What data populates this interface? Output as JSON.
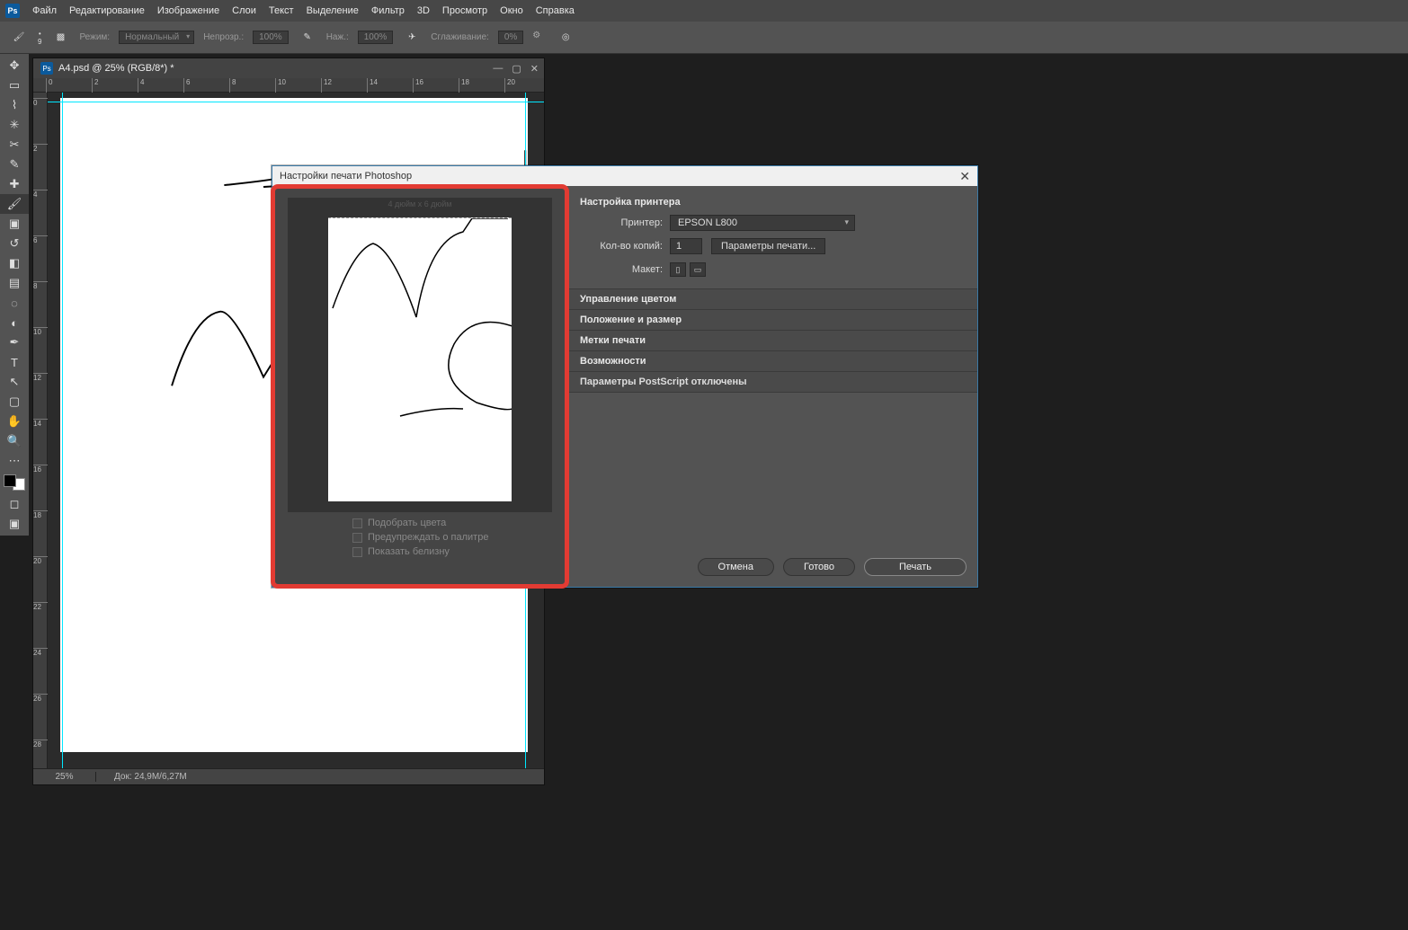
{
  "menu": {
    "items": [
      "Файл",
      "Редактирование",
      "Изображение",
      "Слои",
      "Текст",
      "Выделение",
      "Фильтр",
      "3D",
      "Просмотр",
      "Окно",
      "Справка"
    ]
  },
  "optbar": {
    "brush_size": "9",
    "mode_label": "Режим:",
    "mode_value": "Нормальный",
    "opacity_label": "Непрозр.:",
    "opacity_value": "100%",
    "flow_label": "Наж.:",
    "flow_value": "100%",
    "smooth_label": "Сглаживание:",
    "smooth_value": "0%"
  },
  "doc": {
    "title": "A4.psd @ 25% (RGB/8*) *",
    "zoom": "25%",
    "docinfo": "Док: 24,9M/6,27M",
    "ruler_h": [
      0,
      2,
      4,
      6,
      8,
      10,
      12,
      14,
      16,
      18,
      20
    ],
    "ruler_v": [
      0,
      2,
      4,
      6,
      8,
      10,
      12,
      14,
      16,
      18,
      20,
      22,
      24,
      26,
      28
    ]
  },
  "dialog": {
    "title": "Настройки печати Photoshop",
    "preview_size": "4 дюйм x 6 дюйм",
    "checks": [
      "Подобрать цвета",
      "Предупреждать о палитре",
      "Показать белизну"
    ],
    "setup_header": "Настройка принтера",
    "printer_label": "Принтер:",
    "printer_value": "EPSON L800",
    "copies_label": "Кол-во копий:",
    "copies_value": "1",
    "params_btn": "Параметры печати...",
    "layout_label": "Макет:",
    "sections": [
      "Управление цветом",
      "Положение и размер",
      "Метки печати",
      "Возможности",
      "Параметры PostScript отключены"
    ],
    "btn_cancel": "Отмена",
    "btn_done": "Готово",
    "btn_print": "Печать"
  },
  "tools": [
    {
      "n": "move-icon",
      "g": "✥"
    },
    {
      "n": "marquee-icon",
      "g": "▭"
    },
    {
      "n": "lasso-icon",
      "g": "⌇"
    },
    {
      "n": "wand-icon",
      "g": "✳"
    },
    {
      "n": "crop-icon",
      "g": "✂"
    },
    {
      "n": "eyedropper-icon",
      "g": "✎"
    },
    {
      "n": "heal-icon",
      "g": "✚"
    },
    {
      "n": "brush-icon",
      "g": "🖌",
      "active": true
    },
    {
      "n": "stamp-icon",
      "g": "▣"
    },
    {
      "n": "history-brush-icon",
      "g": "↺"
    },
    {
      "n": "eraser-icon",
      "g": "◧"
    },
    {
      "n": "gradient-icon",
      "g": "▤"
    },
    {
      "n": "blur-icon",
      "g": "◌"
    },
    {
      "n": "dodge-icon",
      "g": "◐"
    },
    {
      "n": "pen-icon",
      "g": "✒"
    },
    {
      "n": "type-icon",
      "g": "T"
    },
    {
      "n": "path-icon",
      "g": "↖"
    },
    {
      "n": "shape-icon",
      "g": "▢"
    },
    {
      "n": "hand-icon",
      "g": "✋"
    },
    {
      "n": "zoom-icon",
      "g": "🔍"
    },
    {
      "n": "edit-toolbar-icon",
      "g": "⋯"
    }
  ]
}
